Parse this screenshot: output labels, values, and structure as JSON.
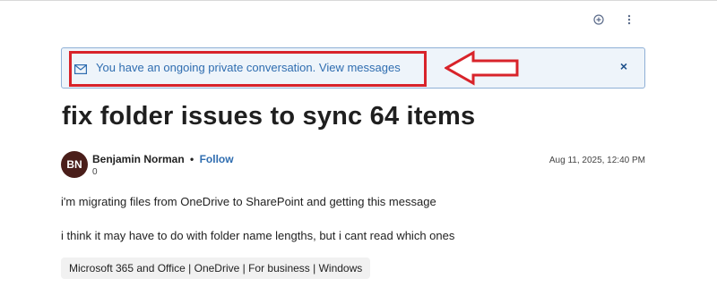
{
  "toolbar": {
    "add_icon": "plus-circle-icon",
    "more_icon": "more-vertical-icon"
  },
  "banner": {
    "icon": "mail-icon",
    "message": "You have an ongoing private conversation.",
    "link": "View messages",
    "close_glyph": "×"
  },
  "annotation": {
    "highlight_color": "#d8232a"
  },
  "post": {
    "title": "fix folder issues to sync 64 items",
    "author": {
      "initials": "BN",
      "name": "Benjamin Norman",
      "separator": "•",
      "follow_label": "Follow",
      "score": "0"
    },
    "date": "Aug 11, 2025, 12:40 PM",
    "body": [
      "i'm migrating files from OneDrive to SharePoint and getting this message",
      "i think it may have to do with folder name lengths, but i cant read which ones"
    ],
    "tags": "Microsoft 365 and Office | OneDrive | For business | Windows"
  },
  "colors": {
    "accent": "#2f6db0",
    "banner_bg": "#eef4fa",
    "avatar_bg": "#4a1e1a"
  }
}
